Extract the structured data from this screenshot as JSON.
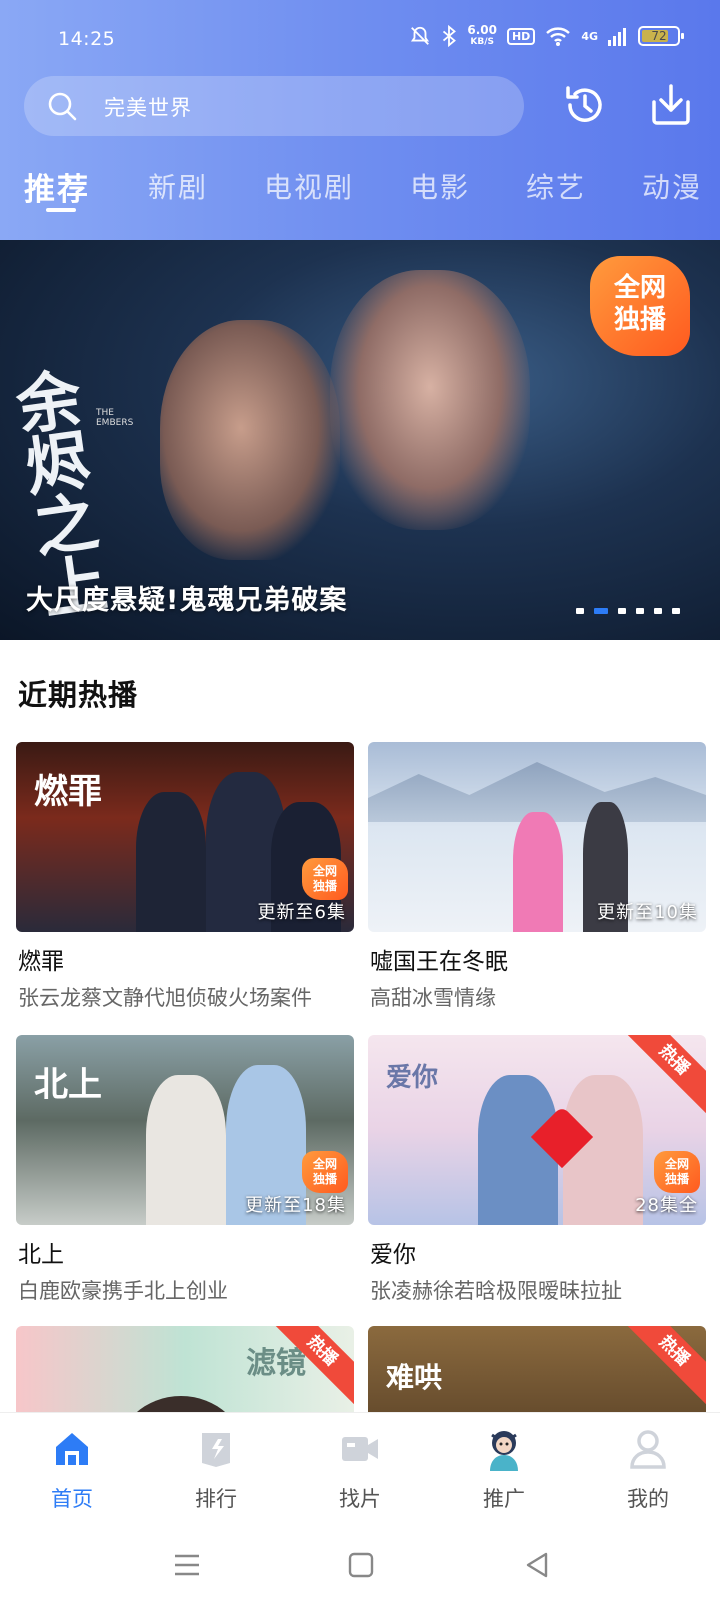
{
  "status": {
    "time": "14:25",
    "net_speed_value": "6.00",
    "net_speed_unit": "KB/S",
    "hd": "HD",
    "signal": "4G",
    "battery": "72"
  },
  "search": {
    "placeholder": "完美世界"
  },
  "tabs": [
    "推荐",
    "新剧",
    "电视剧",
    "电影",
    "综艺",
    "动漫"
  ],
  "banner": {
    "caption": "大尺度悬疑!鬼魂兄弟破案",
    "poster_title": "余烬之上",
    "poster_subtitle": "THE EMBERS",
    "badge": "全网独播",
    "dots": 6,
    "active_dot": 1
  },
  "section": {
    "title": "近期热播"
  },
  "cards": [
    {
      "title": "燃罪",
      "desc": "张云龙蔡文静代旭侦破火场案件",
      "update": "更新至6集",
      "badge": "全网独播",
      "poster": "燃罪"
    },
    {
      "title": "嘘国王在冬眠",
      "desc": "高甜冰雪情缘",
      "update": "更新至10集"
    },
    {
      "title": "北上",
      "desc": "白鹿欧豪携手北上创业",
      "update": "更新至18集",
      "badge": "全网独播",
      "poster": "北上"
    },
    {
      "title": "爱你",
      "desc": "张凌赫徐若晗极限暧昧拉扯",
      "update": "28集全",
      "badge": "全网独播",
      "ribbon": "热播",
      "poster": "爱你"
    },
    {
      "ribbon": "热播",
      "poster": "滤镜"
    },
    {
      "ribbon": "热播",
      "poster": "难哄"
    }
  ],
  "bottom_nav": [
    {
      "label": "首页",
      "icon": "home-icon",
      "active": true
    },
    {
      "label": "排行",
      "icon": "ranking-icon"
    },
    {
      "label": "找片",
      "icon": "video-camera-icon"
    },
    {
      "label": "推广",
      "icon": "promo-avatar-icon"
    },
    {
      "label": "我的",
      "icon": "profile-icon"
    }
  ],
  "colors": {
    "accent": "#2d7cf6",
    "header_start": "#8aa8f5",
    "header_end": "#5a78ec",
    "hot_ribbon": "#f04a3a"
  }
}
